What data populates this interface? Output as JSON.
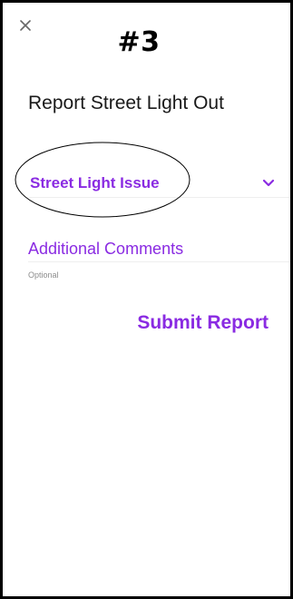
{
  "icons": {
    "close": "close-icon",
    "dropdown": "chevron-down-icon"
  },
  "header": {
    "step_label": "#3"
  },
  "page": {
    "title": "Report Street Light Out"
  },
  "form": {
    "issue_dropdown": {
      "selected_value": "Street Light Issue"
    },
    "comments": {
      "label": "Additional Comments",
      "helper": "Optional"
    },
    "submit_label": "Submit Report"
  },
  "colors": {
    "accent": "#8a2be2",
    "frame_border": "#000000",
    "helper_text": "#8c8c8c"
  }
}
